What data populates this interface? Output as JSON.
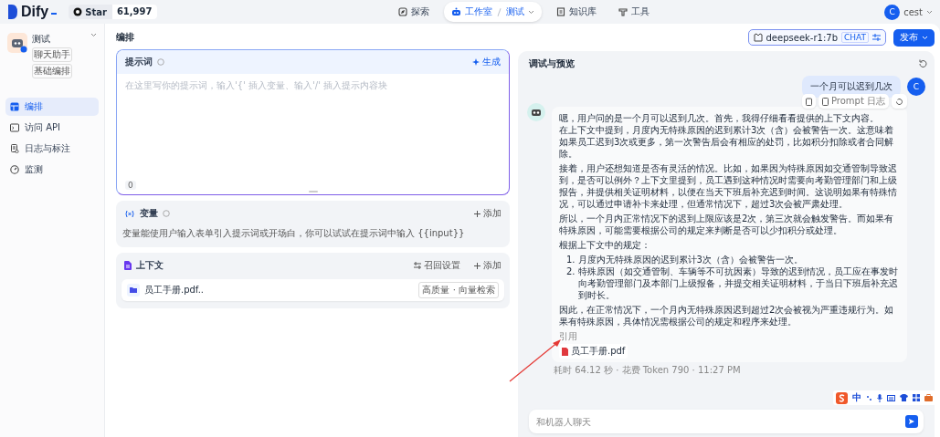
{
  "nav": {
    "logo": "Dify",
    "star": "Star",
    "star_count": "61,997",
    "items": [
      {
        "label": "探索",
        "selected": false
      },
      {
        "label": "工作室",
        "selected": true,
        "sub": "测试"
      },
      {
        "label": "知识库",
        "selected": false
      },
      {
        "label": "工具",
        "selected": false
      }
    ],
    "user": {
      "initial": "C",
      "name": "cest"
    }
  },
  "app": {
    "name": "测试",
    "tags": [
      "聊天助手",
      "基础编排"
    ]
  },
  "sidebar": {
    "items": [
      {
        "label": "编排",
        "selected": true
      },
      {
        "label": "访问 API",
        "selected": false
      },
      {
        "label": "日志与标注",
        "selected": false
      },
      {
        "label": "监测",
        "selected": false
      }
    ]
  },
  "editor": {
    "title": "编排",
    "prompt": {
      "title": "提示词",
      "generate": "生成",
      "placeholder": "在这里写你的提示词，输入'{' 插入变量、输入'/' 插入提示内容块",
      "count": "0"
    },
    "variables": {
      "title": "变量",
      "add": "添加",
      "hint": "变量能使用户输入表单引入提示词或开场白，你可以试试在提示词中输入 {{input}}"
    },
    "context": {
      "title": "上下文",
      "retrieval": "召回设置",
      "add": "添加",
      "datasets": [
        {
          "name": "员工手册.pdf..",
          "badge": "高质量 · 向量检索"
        }
      ]
    }
  },
  "model": {
    "name": "deepseek-r1:7b",
    "mode": "CHAT"
  },
  "publish": "发布",
  "preview": {
    "title": "调试与预览",
    "messages": [
      {
        "kind": "question",
        "initial": "C",
        "text": "一个月可以迟到几次"
      },
      {
        "kind": "answer",
        "log": "Prompt 日志",
        "paragraphs": [
          {
            "kind": "text",
            "lines": [
              "嗯，用户问的是一个月可以迟到几次。首先，我得仔细看看提供的上下文内容。",
              "在上下文中提到，月度内无特殊原因的迟到累计3次（含）会被警告一次。这意味着如果员工迟到3次或更多，第一次警告后会有相应的处罚，比如积分扣除或者合同解除。"
            ]
          },
          {
            "kind": "text",
            "lines": [
              "接着，用户还想知道是否有灵活的情况。比如，如果因为特殊原因如交通管制导致迟到，是否可以例外？上下文里提到，员工遇到这种情况时需要向考勤管理部门和上级报告，并提供相关证明材料，以便在当天下班后补充迟到时间。这说明如果有特殊情况，可以通过申请补卡来处理，但通常情况下，超过3次会被严肃处理。"
            ]
          },
          {
            "kind": "text",
            "lines": [
              "所以，一个月内正常情况下的迟到上限应该是2次，第三次就会触发警告。而如果有特殊原因，可能需要根据公司的规定来判断是否可以少扣积分或处理。"
            ]
          },
          {
            "kind": "text",
            "lines": [
              "根据上下文中的规定："
            ]
          },
          {
            "kind": "list",
            "items": [
              {
                "marker": "1.",
                "text": "月度内无特殊原因的迟到累计3次（含）会被警告一次。"
              },
              {
                "marker": "2.",
                "text": "特殊原因（如交通管制、车辆等不可抗因素）导致的迟到情况，员工应在事发时向考勤管理部门及本部门上级报备，并提交相关证明材料，于当日下班后补充迟到时长。"
              }
            ]
          },
          {
            "kind": "text",
            "lines": [
              "因此，在正常情况下，一个月内无特殊原因迟到超过2次会被视为严重违规行为。如果有特殊原因，具体情况需根据公司的规定和程序来处理。"
            ]
          }
        ],
        "citation_title": "引用",
        "citations": [
          "员工手册.pdf"
        ],
        "meta": "耗时 64.12 秒 · 花费 Token 790 · 11:27 PM"
      }
    ],
    "input_placeholder": "和机器人聊天"
  },
  "ime": {
    "mode": "中"
  }
}
